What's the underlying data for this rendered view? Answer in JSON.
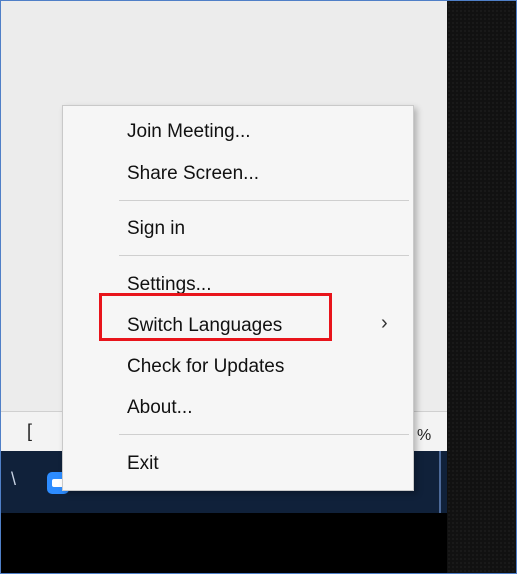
{
  "context_menu": {
    "items": [
      {
        "label": "Join Meeting..."
      },
      {
        "label": "Share Screen..."
      },
      {
        "label": "Sign in"
      },
      {
        "label": "Settings..."
      },
      {
        "label": "Switch Languages"
      },
      {
        "label": "Check for Updates"
      },
      {
        "label": "About..."
      },
      {
        "label": "Exit"
      }
    ],
    "submenu_indicator": "›"
  },
  "background": {
    "status_bracket": "[",
    "status_percent": "%"
  },
  "icons": [
    "zoom-app-icon",
    "network-icon",
    "volume-icon",
    "chevron-right-icon"
  ],
  "colors": {
    "highlight_border": "#e8141b",
    "taskbar": "#10213a",
    "zoom_blue": "#2d8cff"
  }
}
